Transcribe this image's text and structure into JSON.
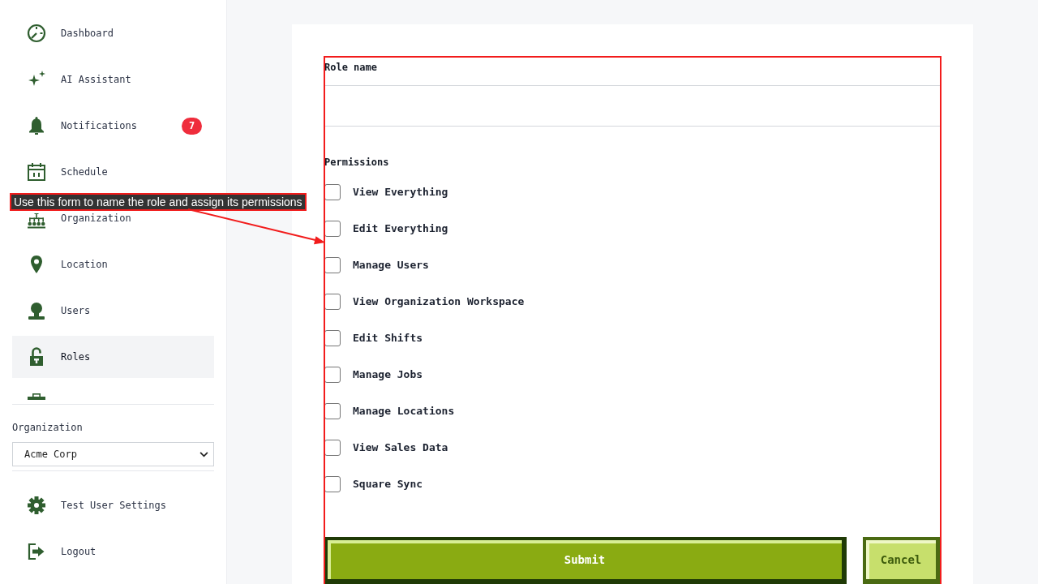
{
  "sidebar": {
    "nav_items": [
      {
        "label": "Dashboard",
        "selected": false
      },
      {
        "label": "AI Assistant",
        "selected": false
      },
      {
        "label": "Notifications",
        "selected": false,
        "badge": "7"
      },
      {
        "label": "Schedule",
        "selected": false
      },
      {
        "label": "Organization",
        "selected": false
      },
      {
        "label": "Location",
        "selected": false
      },
      {
        "label": "Users",
        "selected": false
      },
      {
        "label": "Roles",
        "selected": true
      },
      {
        "selected": false
      }
    ],
    "organization": {
      "label": "Organization",
      "value": "Acme Corp"
    },
    "footer_items": [
      {
        "label": "Test User Settings"
      },
      {
        "label": "Logout"
      }
    ]
  },
  "form": {
    "role_name": {
      "label": "Role name"
    },
    "permissions": {
      "label": "Permissions",
      "items": [
        {
          "label": "View Everything",
          "checked": false
        },
        {
          "label": "Edit Everything",
          "checked": false
        },
        {
          "label": "Manage Users",
          "checked": false
        },
        {
          "label": "View Organization Workspace",
          "checked": false
        },
        {
          "label": "Edit Shifts",
          "checked": false
        },
        {
          "label": "Manage Jobs",
          "checked": false
        },
        {
          "label": "Manage Locations",
          "checked": false
        },
        {
          "label": "View Sales Data",
          "checked": false
        },
        {
          "label": "Square Sync",
          "checked": false
        }
      ]
    },
    "buttons": [
      {
        "label": "Submit",
        "kind": "primary"
      },
      {
        "label": "Cancel",
        "kind": "secondary"
      }
    ]
  },
  "annotation": {
    "text": "Use this form to name the role and assign its permissions"
  }
}
